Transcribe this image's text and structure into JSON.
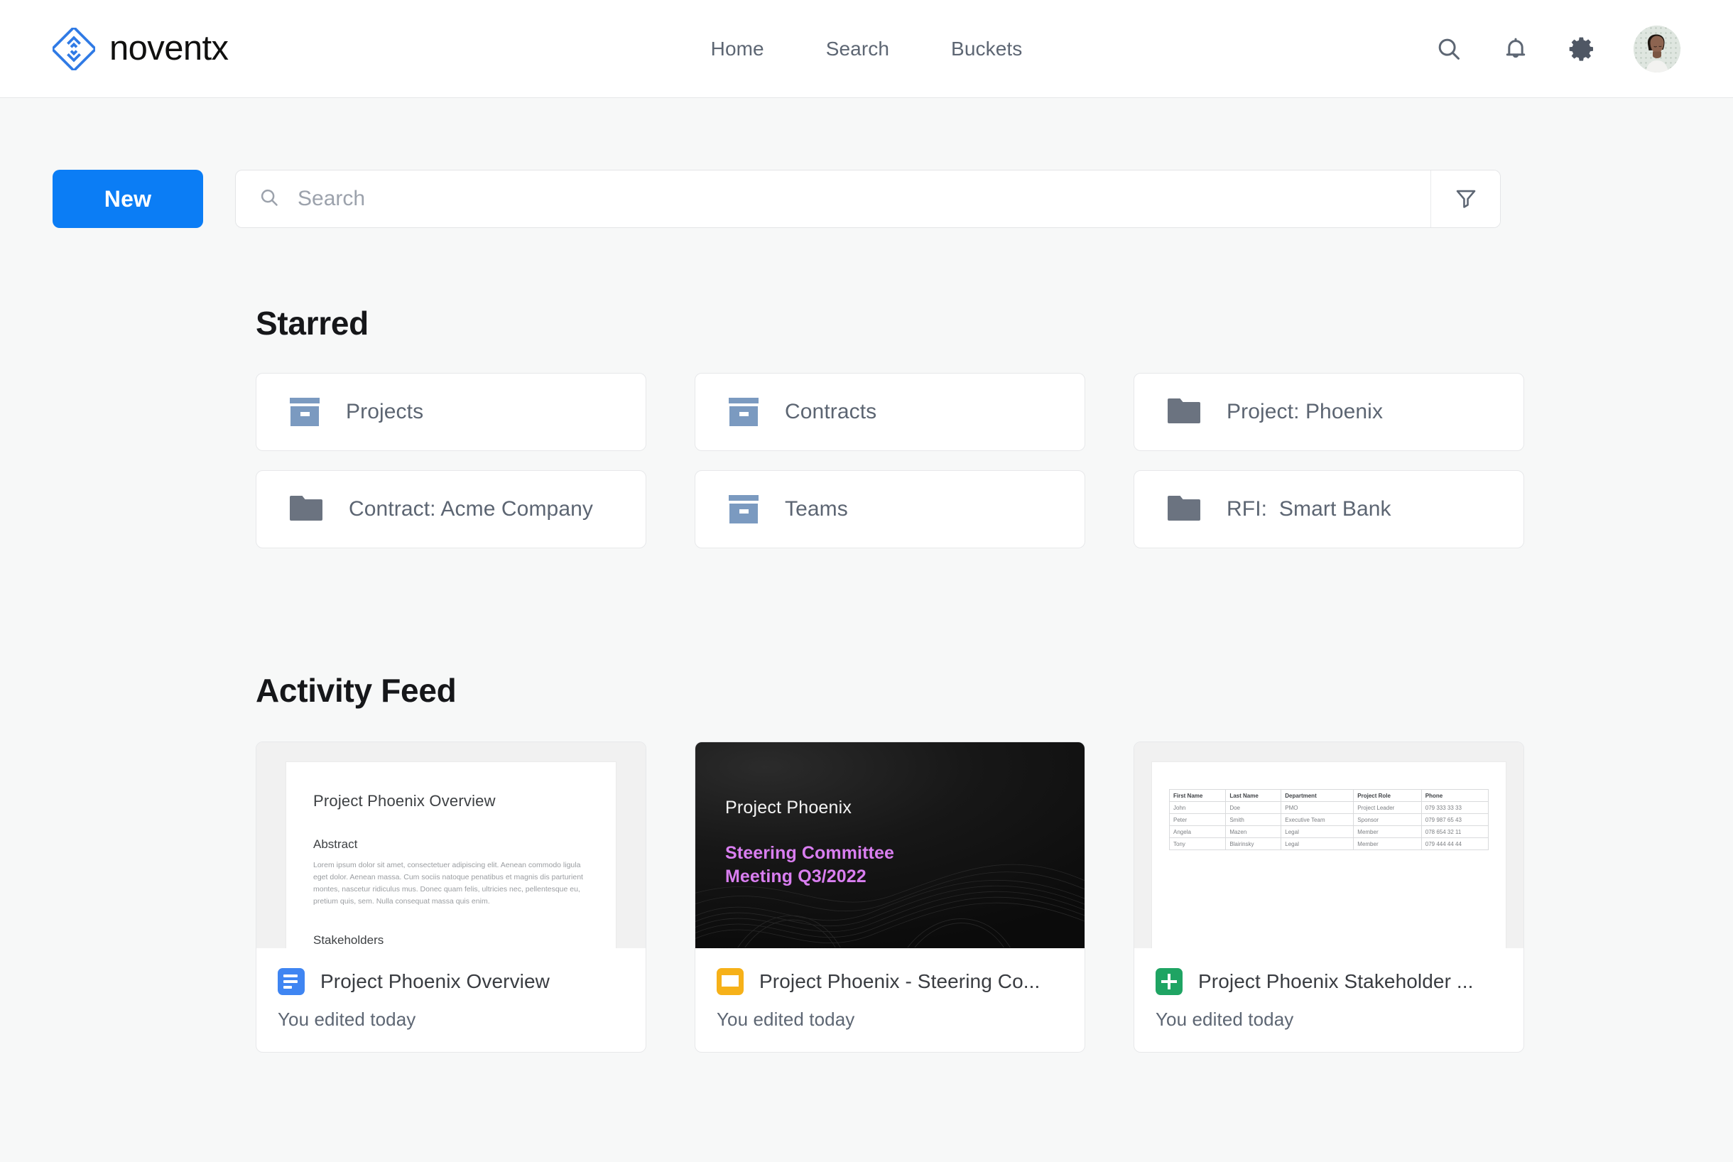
{
  "brand": {
    "name": "noventx",
    "logo_icon": "noventx-diamond-logo",
    "accent": "#2f7ae5"
  },
  "topnav": {
    "links": [
      {
        "label": "Home",
        "name": "home"
      },
      {
        "label": "Search",
        "name": "search"
      },
      {
        "label": "Buckets",
        "name": "buckets"
      }
    ],
    "actions": [
      {
        "icon": "search-icon"
      },
      {
        "icon": "bell-icon"
      },
      {
        "icon": "gear-icon"
      },
      {
        "icon": "avatar"
      }
    ]
  },
  "toolbar": {
    "new_label": "New",
    "new_color": "#0b7df5",
    "search_placeholder": "Search",
    "search_value": "",
    "search_icon": "search-icon",
    "filter_icon": "filter-funnel-icon"
  },
  "starred": {
    "title": "Starred",
    "items": [
      {
        "label": "Projects",
        "icon": "bucket-icon"
      },
      {
        "label": "Contracts",
        "icon": "bucket-icon"
      },
      {
        "label": "Project: Phoenix",
        "icon": "folder-icon"
      },
      {
        "label": "Contract: Acme Company",
        "icon": "folder-icon"
      },
      {
        "label": "Teams",
        "icon": "bucket-icon"
      },
      {
        "label": "RFI:  Smart Bank",
        "icon": "folder-icon"
      }
    ]
  },
  "activity_feed": {
    "title": "Activity Feed",
    "cards": [
      {
        "title": "Project Phoenix Overview",
        "subtitle": "You edited today",
        "file_icon": "google-docs-icon",
        "file_color": "#3f85f2",
        "thumbnail": {
          "type": "document",
          "heading": "Project Phoenix Overview",
          "section1_heading": "Abstract",
          "section1_body": "Lorem ipsum dolor sit amet, consectetuer adipiscing elit. Aenean commodo ligula eget dolor. Aenean massa. Cum sociis natoque penatibus et magnis dis parturient montes, nascetur ridiculus mus. Donec quam felis, ultricies nec, pellentesque eu, pretium quis, sem. Nulla consequat massa quis enim.",
          "section2_heading": "Stakeholders"
        }
      },
      {
        "title": "Project Phoenix - Steering Co...",
        "subtitle": "You edited today",
        "file_icon": "google-slides-icon",
        "file_color": "#f6b119",
        "thumbnail": {
          "type": "slide",
          "title": "Project Phoenix",
          "subtitle": "Steering Committee\nMeeting Q3/2022",
          "subtitle_line1": "Steering Committee",
          "subtitle_line2": "Meeting Q3/2022",
          "accent": "#d97ef0",
          "background": "#121212"
        }
      },
      {
        "title": "Project Phoenix Stakeholder ...",
        "subtitle": "You edited today",
        "file_icon": "google-sheets-icon",
        "file_color": "#1fa463",
        "thumbnail": {
          "type": "spreadsheet",
          "columns": [
            "First Name",
            "Last Name",
            "Department",
            "Project Role",
            "Phone"
          ],
          "rows": [
            [
              "John",
              "Doe",
              "PMO",
              "Project Leader",
              "079 333 33 33"
            ],
            [
              "Peter",
              "Smith",
              "Executive Team",
              "Sponsor",
              "079 987 65 43"
            ],
            [
              "Angela",
              "Mazen",
              "Legal",
              "Member",
              "078 654 32 11"
            ],
            [
              "Tony",
              "Blairinsky",
              "Legal",
              "Member",
              "079 444 44 44"
            ]
          ]
        }
      }
    ]
  }
}
